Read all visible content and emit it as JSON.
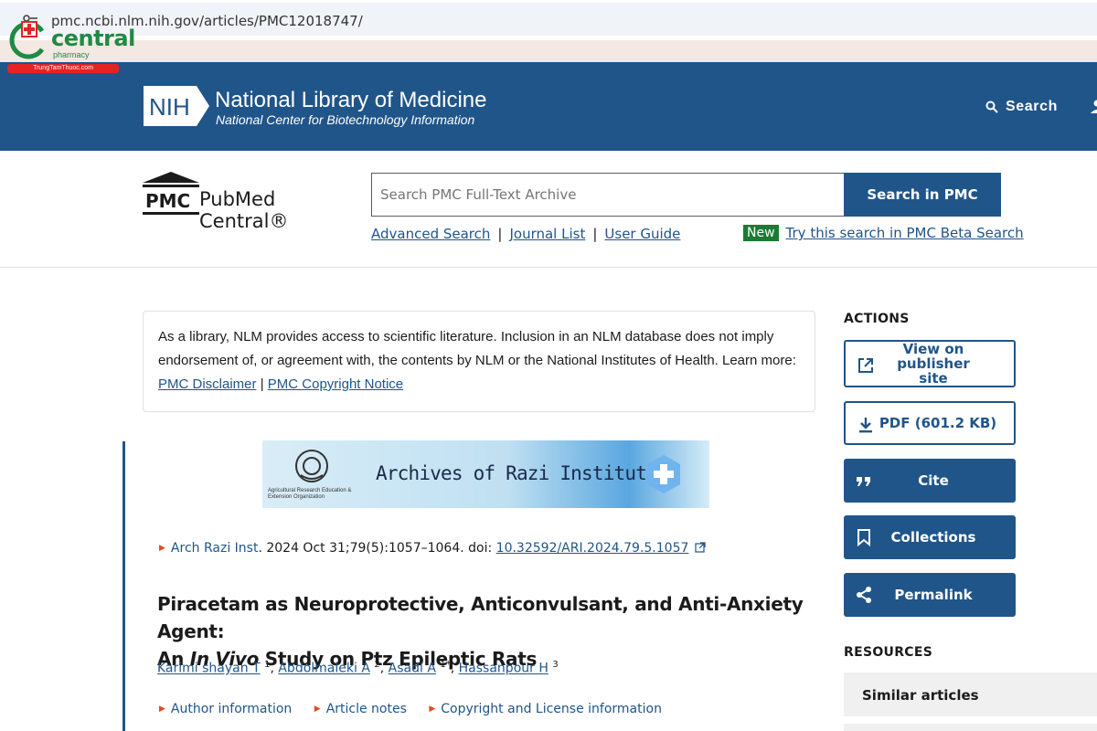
{
  "browser": {
    "url": "pmc.ncbi.nlm.nih.gov/articles/PMC12018747/"
  },
  "watermark": {
    "brand": "central",
    "sub": "pharmacy",
    "tag": "TrungTamThuoc.com"
  },
  "nih_header": {
    "badge": "NIH",
    "title": "National Library of Medicine",
    "subtitle": "National Center for Biotechnology Information",
    "search_label": "Search"
  },
  "pmc": {
    "logo_abbr": "PMC",
    "logo_text": "PubMed Central®",
    "search_placeholder": "Search PMC Full-Text Archive",
    "search_button": "Search in PMC",
    "links": [
      "Advanced Search",
      "Journal List",
      "User Guide"
    ],
    "new_badge": "New",
    "beta_link": "Try this search in PMC Beta Search"
  },
  "notice": {
    "text": "As a library, NLM provides access to scientific literature. Inclusion in an NLM database does not imply endorsement of, or agreement with, the contents by NLM or the National Institutes of Health.",
    "learn_more": "Learn more:",
    "disclaimer_link": "PMC Disclaimer",
    "separator": "|",
    "copyright_link": "PMC Copyright Notice"
  },
  "article": {
    "banner_title": "Archives of Razi Institute",
    "banner_sub": "Agricultural Research Education & Extension Organization",
    "journal": "Arch Razi Inst",
    "citation_rest": ". 2024 Oct 31;79(5):1057–1064. doi: ",
    "doi": "10.32592/ARI.2024.79.5.1057",
    "title_line1": "Piracetam as Neuroprotective, Anticonvulsant, and Anti-Anxiety Agent:",
    "title_prefix": "An ",
    "title_italic": "In Vivo",
    "title_suffix": " Study on Ptz Epileptic Rats",
    "authors": [
      {
        "name": "Karimi shayan T",
        "sup": "1"
      },
      {
        "name": "Abdolmaleki A",
        "sup": "2"
      },
      {
        "name": "Asadi A",
        "sup": "1*"
      },
      {
        "name": "Hassanpour H",
        "sup": "3"
      }
    ],
    "meta_links": [
      "Author information",
      "Article notes",
      "Copyright and License information"
    ]
  },
  "actions": {
    "heading": "ACTIONS",
    "view_publisher": "View on publisher site",
    "pdf": "PDF (601.2 KB)",
    "cite": "Cite",
    "collections": "Collections",
    "permalink": "Permalink"
  },
  "resources": {
    "heading": "RESOURCES",
    "similar": "Similar articles"
  },
  "colors": {
    "nih_blue": "#20558a",
    "new_green": "#1d7a33",
    "marker_orange": "#e04c1e"
  }
}
